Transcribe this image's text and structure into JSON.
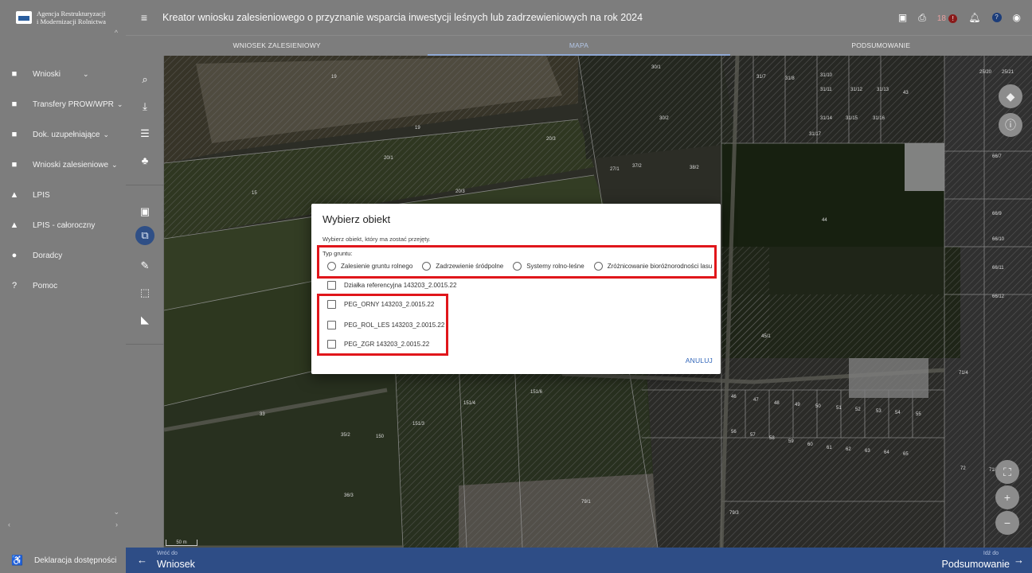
{
  "app": {
    "logo_line1": "Agencja Restrukturyzacji",
    "logo_line2": "i Modernizacji Rolnictwa",
    "title": "Kreator wniosku zalesieniowego o przyznanie wsparcia inwestycji leśnych lub zadrzewieniowych na rok 2024",
    "notification_count": "18",
    "notification_badge": "!"
  },
  "sidebar": {
    "items": [
      {
        "label": "Wnioski",
        "icon": "briefcase-icon",
        "has_chevron": true
      },
      {
        "label": "Transfery PROW/WPR",
        "icon": "briefcase-icon",
        "has_chevron": true
      },
      {
        "label": "Dok. uzupełniające",
        "icon": "briefcase-icon",
        "has_chevron": true
      },
      {
        "label": "Wnioski zalesieniowe",
        "icon": "briefcase-icon",
        "has_chevron": true
      },
      {
        "label": "LPIS",
        "icon": "terrain-icon",
        "has_chevron": false
      },
      {
        "label": "LPIS - całoroczny",
        "icon": "terrain-icon",
        "has_chevron": false
      },
      {
        "label": "Doradcy",
        "icon": "person-icon",
        "has_chevron": false
      },
      {
        "label": "Pomoc",
        "icon": "help-icon",
        "has_chevron": false
      }
    ],
    "footer": "Deklaracja dostępności"
  },
  "tabs": [
    {
      "label": "WNIOSEK ZALESIENIOWY",
      "active": false
    },
    {
      "label": "MAPA",
      "active": true
    },
    {
      "label": "PODSUMOWANIE",
      "active": false
    }
  ],
  "map": {
    "scale_label": "50 m",
    "parcel_labels": [
      "19",
      "19",
      "20/3",
      "20/1",
      "20/3",
      "15",
      "30/1",
      "30/2",
      "31/7",
      "31/8",
      "31/10",
      "31/11",
      "31/12",
      "31/13",
      "43",
      "31/14",
      "31/15",
      "31/16",
      "31/17",
      "37/2",
      "38/2",
      "27/1",
      "44",
      "45/1",
      "151/4",
      "151/3",
      "151/6",
      "35/2",
      "150",
      "36/3",
      "33",
      "79/1",
      "79/3",
      "71/4",
      "71/10",
      "72",
      "46",
      "47",
      "48",
      "49",
      "50",
      "51",
      "52",
      "53",
      "54",
      "55",
      "56",
      "57",
      "58",
      "59",
      "60",
      "61",
      "62",
      "63",
      "64",
      "65",
      "25/20",
      "25/21",
      "66/7",
      "66/9",
      "66/10",
      "66/11",
      "66/12"
    ]
  },
  "bottom": {
    "back_small": "Wróć do",
    "back_big": "Wniosek",
    "next_small": "Idź do",
    "next_big": "Podsumowanie"
  },
  "dialog": {
    "title": "Wybierz obiekt",
    "subtitle": "Wybierz obiekt, który ma zostać przejęty.",
    "type_label": "Typ gruntu:",
    "radio_options": [
      "Zalesienie gruntu rolnego",
      "Zadrzewienie śródpolne",
      "Systemy rolno-leśne",
      "Zróżnicowanie bioróżnorodności lasu"
    ],
    "checkboxes": [
      "Działka referencyjna 143203_2.0015.22",
      "PEG_ORNY 143203_2.0015.22",
      "PEG_ROL_LES 143203_2.0015.22",
      "PEG_ZGR 143203_2.0015.22"
    ],
    "cancel_label": "ANULUJ"
  },
  "colors": {
    "sidebar": "#7d7d7d",
    "bottom_bar": "#2e4d86",
    "highlight": "#e0161b",
    "link": "#2f64b8"
  }
}
